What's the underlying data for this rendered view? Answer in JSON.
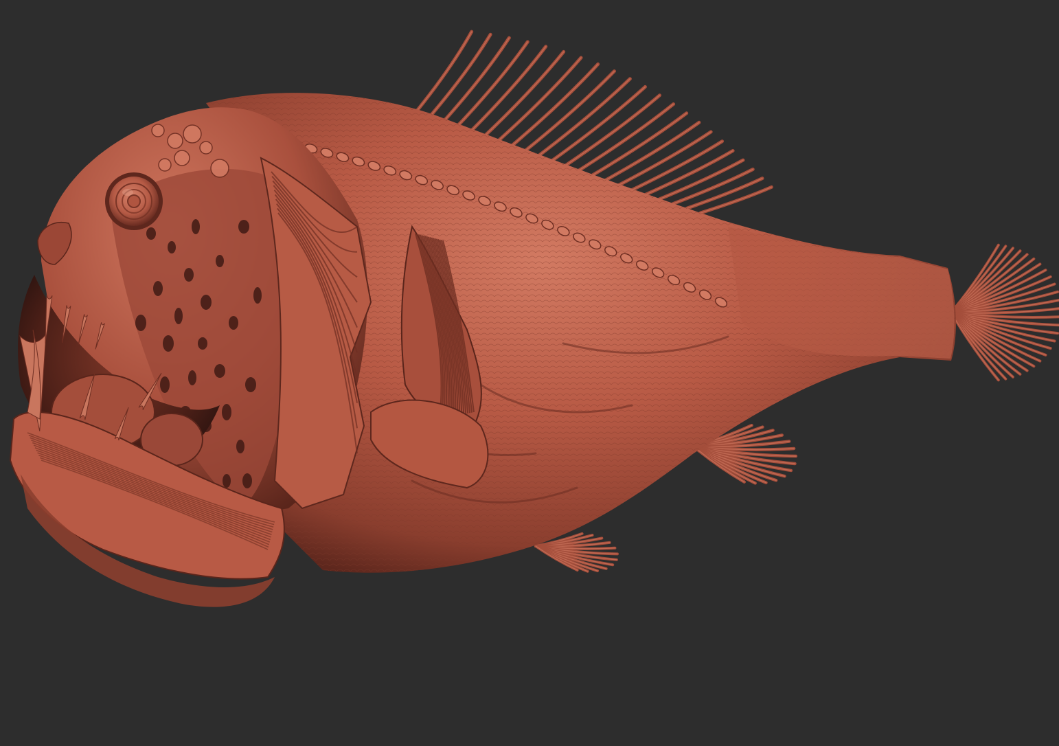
{
  "scene": {
    "background_color": "#2d2d2d",
    "subject": "anglerfish-clay-sculpt",
    "material": {
      "base": "#b85a45",
      "light": "#d27a62",
      "mid": "#a44e3b",
      "shadow": "#6e2e22",
      "deep": "#3f1a14",
      "tooth": "#c9765e"
    },
    "icons": {
      "eye": "eye-icon",
      "fin": "fin-icon"
    }
  }
}
